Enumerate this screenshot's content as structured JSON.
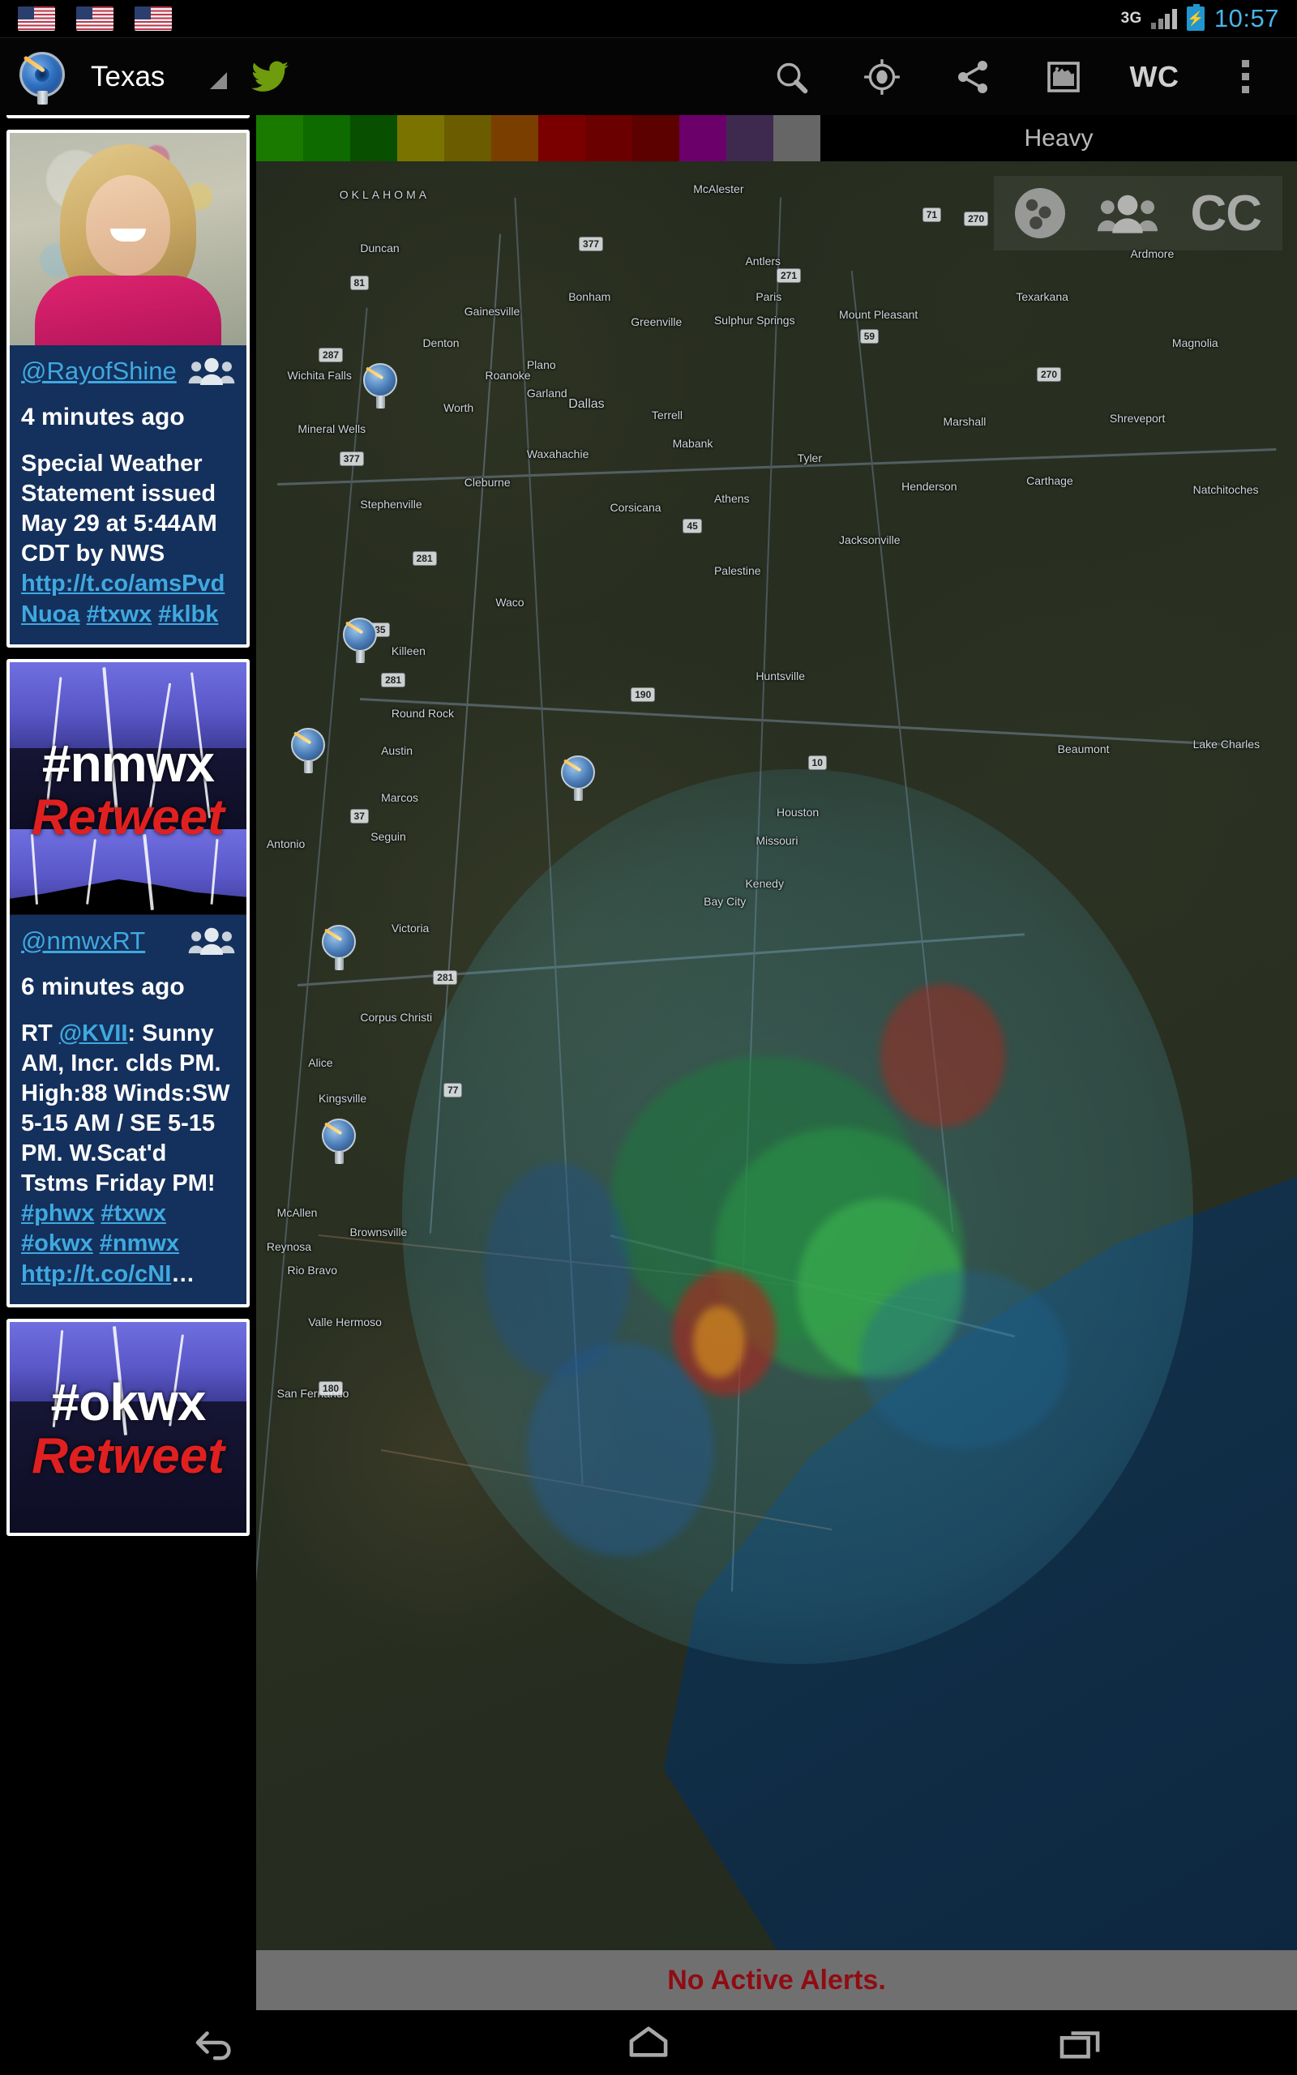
{
  "status_bar": {
    "notification_icons": [
      "us-flag",
      "us-flag",
      "us-flag"
    ],
    "network_type": "3G",
    "battery_state": "charging",
    "time": "10:57"
  },
  "action_bar": {
    "app_icon": "radar-dish-icon",
    "title": "Texas",
    "dropdown_icon": "dropdown-caret-icon",
    "twitter_icon": "twitter-bird-icon",
    "actions": [
      {
        "name": "search-icon",
        "label": ""
      },
      {
        "name": "my-location-icon",
        "label": ""
      },
      {
        "name": "share-icon",
        "label": ""
      },
      {
        "name": "map-layers-icon",
        "label": ""
      },
      {
        "name": "wc-button",
        "label": "WC"
      },
      {
        "name": "overflow-menu-icon",
        "label": ""
      }
    ]
  },
  "legend": {
    "heavy_label": "Heavy",
    "swatches": [
      "#1a7a00",
      "#0d6b00",
      "#084f00",
      "#7a7300",
      "#6b5c00",
      "#7a3f00",
      "#7a0000",
      "#6b0000",
      "#5c0000",
      "#6b006b",
      "#3f2a4f",
      "#666666"
    ]
  },
  "map_overlay": {
    "globe_icon": "globe-icon",
    "group_icon": "group-people-icon",
    "cc_label": "CC"
  },
  "map_labels": [
    "OKLAHOMA",
    "McAlester",
    "Texarkana",
    "Shreveport",
    "Magnolia",
    "Duncan",
    "Ardmore",
    "Antlers",
    "Bonham",
    "Denton",
    "Plano",
    "Garland",
    "Dallas",
    "Worth",
    "Terrell",
    "Tyler",
    "Carthage",
    "Henderson",
    "Natchitoches",
    "Waxahachie",
    "Corsicana",
    "Stephenville",
    "Cleburne",
    "Athens",
    "Jacksonville",
    "Palestine",
    "Waco",
    "Killeen",
    "Huntsville",
    "Round Rock",
    "Austin",
    "Beaumont",
    "Lake Charles",
    "Marcos",
    "Seguin",
    "Antonio",
    "Houston",
    "Missouri",
    "Victoria",
    "Bay City",
    "Kenedy",
    "Corpus Christi",
    "Alice",
    "Kingsville",
    "McAllen",
    "Reynosa",
    "Rio Bravo",
    "Brownsville",
    "Valle Hermoso",
    "San Fernando",
    "Mount Pleasant",
    "Sulphur Springs",
    "Wichita Falls",
    "Mineral Wells",
    "Gainesville",
    "Roanoke",
    "Greenville",
    "Paris",
    "Mabank",
    "Marshall"
  ],
  "alert_bar": {
    "text": "No Active Alerts."
  },
  "nav_bar": {
    "buttons": [
      {
        "name": "back-button",
        "icon": "back-arrow-icon"
      },
      {
        "name": "home-button",
        "icon": "home-icon"
      },
      {
        "name": "recents-button",
        "icon": "recent-apps-icon"
      }
    ]
  },
  "tweets": [
    {
      "id": "partial-top",
      "type": "partial",
      "handle": "",
      "time": "",
      "text_html": ""
    },
    {
      "id": "rayofshine",
      "type": "photo",
      "image_kind": "portrait-photo",
      "handle": "@RayofShine",
      "people_icon": "group-people-icon",
      "time": "4 minutes ago",
      "text_html": "Special Weather Statement issued May 29 at 5:44AM CDT by NWS <a href=\"#\" data-name=\"tweet-link\">http://t.co/amsPvdNuoa</a> <a href=\"#\" data-name=\"tweet-hashtag\">#txwx</a> <a href=\"#\" data-name=\"tweet-hashtag\">#klbk</a>"
    },
    {
      "id": "nmwxrt",
      "type": "banner",
      "image_kind": "lightning-banner",
      "banner_tag": "#nmwx",
      "banner_rt": "Retweet",
      "handle": "@nmwxRT",
      "people_icon": "group-people-icon",
      "time": "6 minutes ago",
      "text_html": "RT <a href=\"#\" data-name=\"tweet-mention\">@KVII</a>: Sunny AM, Incr. clds PM. High:88 Winds:SW 5-15 AM / SE 5-15 PM. W.Scat'd Tstms Friday PM! <a href=\"#\" data-name=\"tweet-hashtag\">#phwx</a> <a href=\"#\" data-name=\"tweet-hashtag\">#txwx</a> <a href=\"#\" data-name=\"tweet-hashtag\">#okwx</a> <a href=\"#\" data-name=\"tweet-hashtag\">#nmwx</a> <a href=\"#\" data-name=\"tweet-link\">http://t.co/cNI</a>…"
    },
    {
      "id": "okwxrt",
      "type": "banner-partial",
      "image_kind": "lightning-banner",
      "banner_tag": "#okwx",
      "banner_rt": "Retweet",
      "handle": "",
      "time": "",
      "text_html": ""
    }
  ]
}
